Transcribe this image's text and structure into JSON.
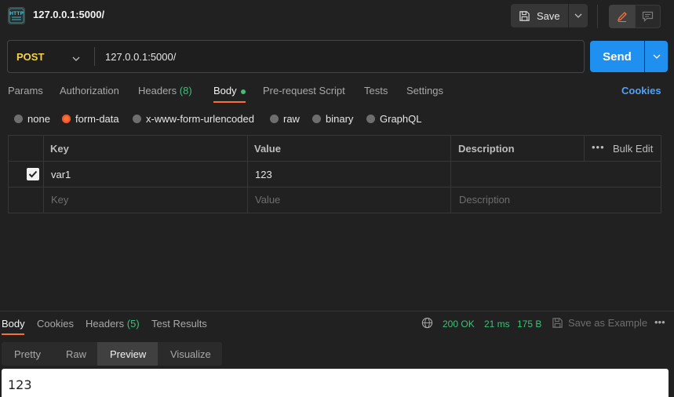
{
  "header": {
    "title": "127.0.0.1:5000/",
    "save_label": "Save"
  },
  "request": {
    "method": "POST",
    "url": "127.0.0.1:5000/",
    "send_label": "Send"
  },
  "request_tabs": {
    "params": "Params",
    "authorization": "Authorization",
    "headers": "Headers",
    "headers_count": "(8)",
    "body": "Body",
    "pre_request": "Pre-request Script",
    "tests": "Tests",
    "settings": "Settings",
    "cookies": "Cookies"
  },
  "body_types": {
    "none": "none",
    "form_data": "form-data",
    "urlencoded": "x-www-form-urlencoded",
    "raw": "raw",
    "binary": "binary",
    "graphql": "GraphQL",
    "selected": "form-data"
  },
  "table": {
    "headers": {
      "key": "Key",
      "value": "Value",
      "description": "Description",
      "bulk_edit": "Bulk Edit"
    },
    "rows": [
      {
        "key": "var1",
        "value": "123",
        "description": "",
        "checked": true
      }
    ],
    "placeholders": {
      "key": "Key",
      "value": "Value",
      "description": "Description"
    }
  },
  "response": {
    "tabs": {
      "body": "Body",
      "cookies": "Cookies",
      "headers": "Headers",
      "headers_count": "(5)",
      "test_results": "Test Results"
    },
    "status": "200 OK",
    "time": "21 ms",
    "size": "175 B",
    "save_example": "Save as Example",
    "view_tabs": {
      "pretty": "Pretty",
      "raw": "Raw",
      "preview": "Preview",
      "visualize": "Visualize",
      "selected": "Preview"
    },
    "body_text": "123"
  },
  "colors": {
    "background": "#212121",
    "accent": "#ff6c37",
    "send_blue": "#1f8ff0",
    "status_green": "#3dc07a",
    "method_yellow": "#f6d343",
    "link_blue": "#4aa3ff"
  }
}
